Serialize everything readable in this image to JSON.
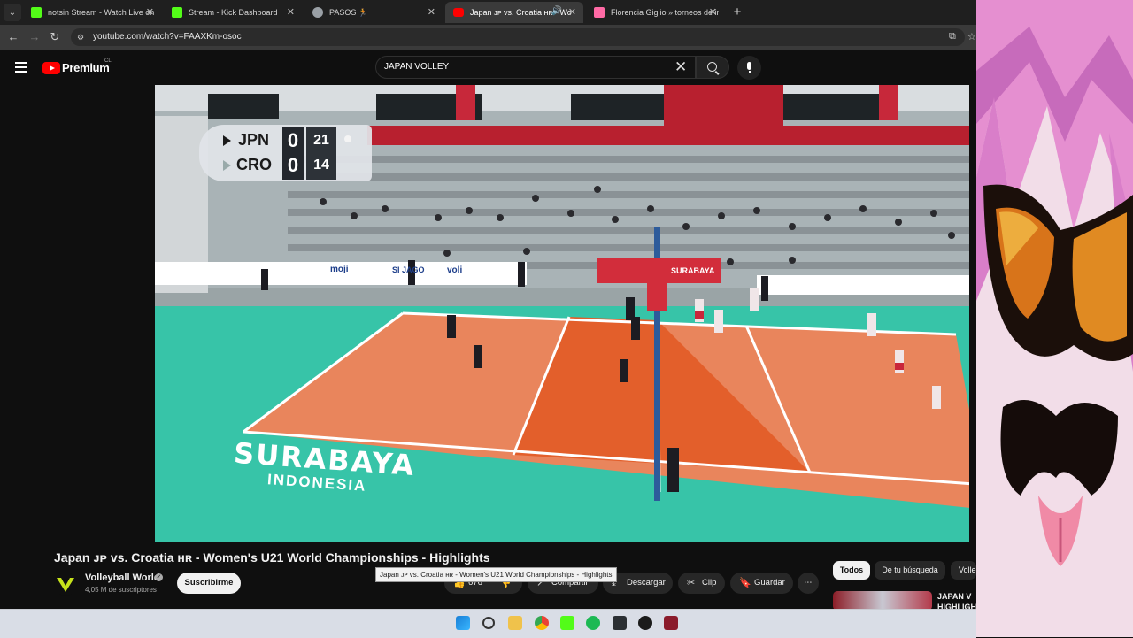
{
  "browser": {
    "tabs": [
      {
        "label": "notsin Stream - Watch Live on",
        "favicon": "kick-icon",
        "color": "#53fc18",
        "active": false
      },
      {
        "label": "Stream - Kick Dashboard",
        "favicon": "kick-icon",
        "color": "#53fc18",
        "active": false
      },
      {
        "label": "PASOS 🏃",
        "favicon": "globe-icon",
        "color": "#9aa0a6",
        "active": false
      },
      {
        "label": "Japan ᴊᴘ vs. Croatia ʜʀ - Wo",
        "favicon": "youtube-icon",
        "color": "#ff0000",
        "active": true
      },
      {
        "label": "Florencia Giglio » torneos de in",
        "favicon": "challonge-icon",
        "color": "#ff6aa5",
        "active": false
      }
    ],
    "new_tab_label": "+",
    "url": "youtube.com/watch?v=FAAXKm-osoc"
  },
  "youtube": {
    "brand": "Premium",
    "brand_region": "CL",
    "search_value": "JAPAN VOLLEY",
    "scoreboard": {
      "team1": "JPN",
      "team1_sets": "0",
      "team1_points": "21",
      "team2": "CRO",
      "team2_sets": "0",
      "team2_points": "14"
    },
    "video_title": "Japan ᴊᴘ vs. Croatia ʜʀ - Women's U21 World Championships - Highlights",
    "tooltip": "Japan ᴊᴘ vs. Croatia ʜʀ - Women's U21 World Championships - Highlights",
    "channel": {
      "name": "Volleyball World",
      "subscribers": "4,05 M de suscriptores",
      "subscribe_label": "Suscribirme"
    },
    "actions": {
      "likes": "676",
      "share": "Compartir",
      "download": "Descargar",
      "clip": "Clip",
      "save": "Guardar",
      "more": "⋯"
    },
    "chips": [
      "Todos",
      "De tu búsqueda",
      "Volle"
    ],
    "recommendation": {
      "title": "JAPAN V\nHIGHLIGH"
    },
    "court_text": {
      "city": "SURABAYA",
      "country": "INDONESIA",
      "banner": "SURABAYA",
      "sponsor1": "moji",
      "sponsor2": "SI JAGO",
      "sponsor3": "voli"
    }
  },
  "colors": {
    "youtube_red": "#ff0000",
    "court_inner": "#e35f2b",
    "court_outer": "#37c4a8",
    "kick_green": "#53fc18"
  }
}
